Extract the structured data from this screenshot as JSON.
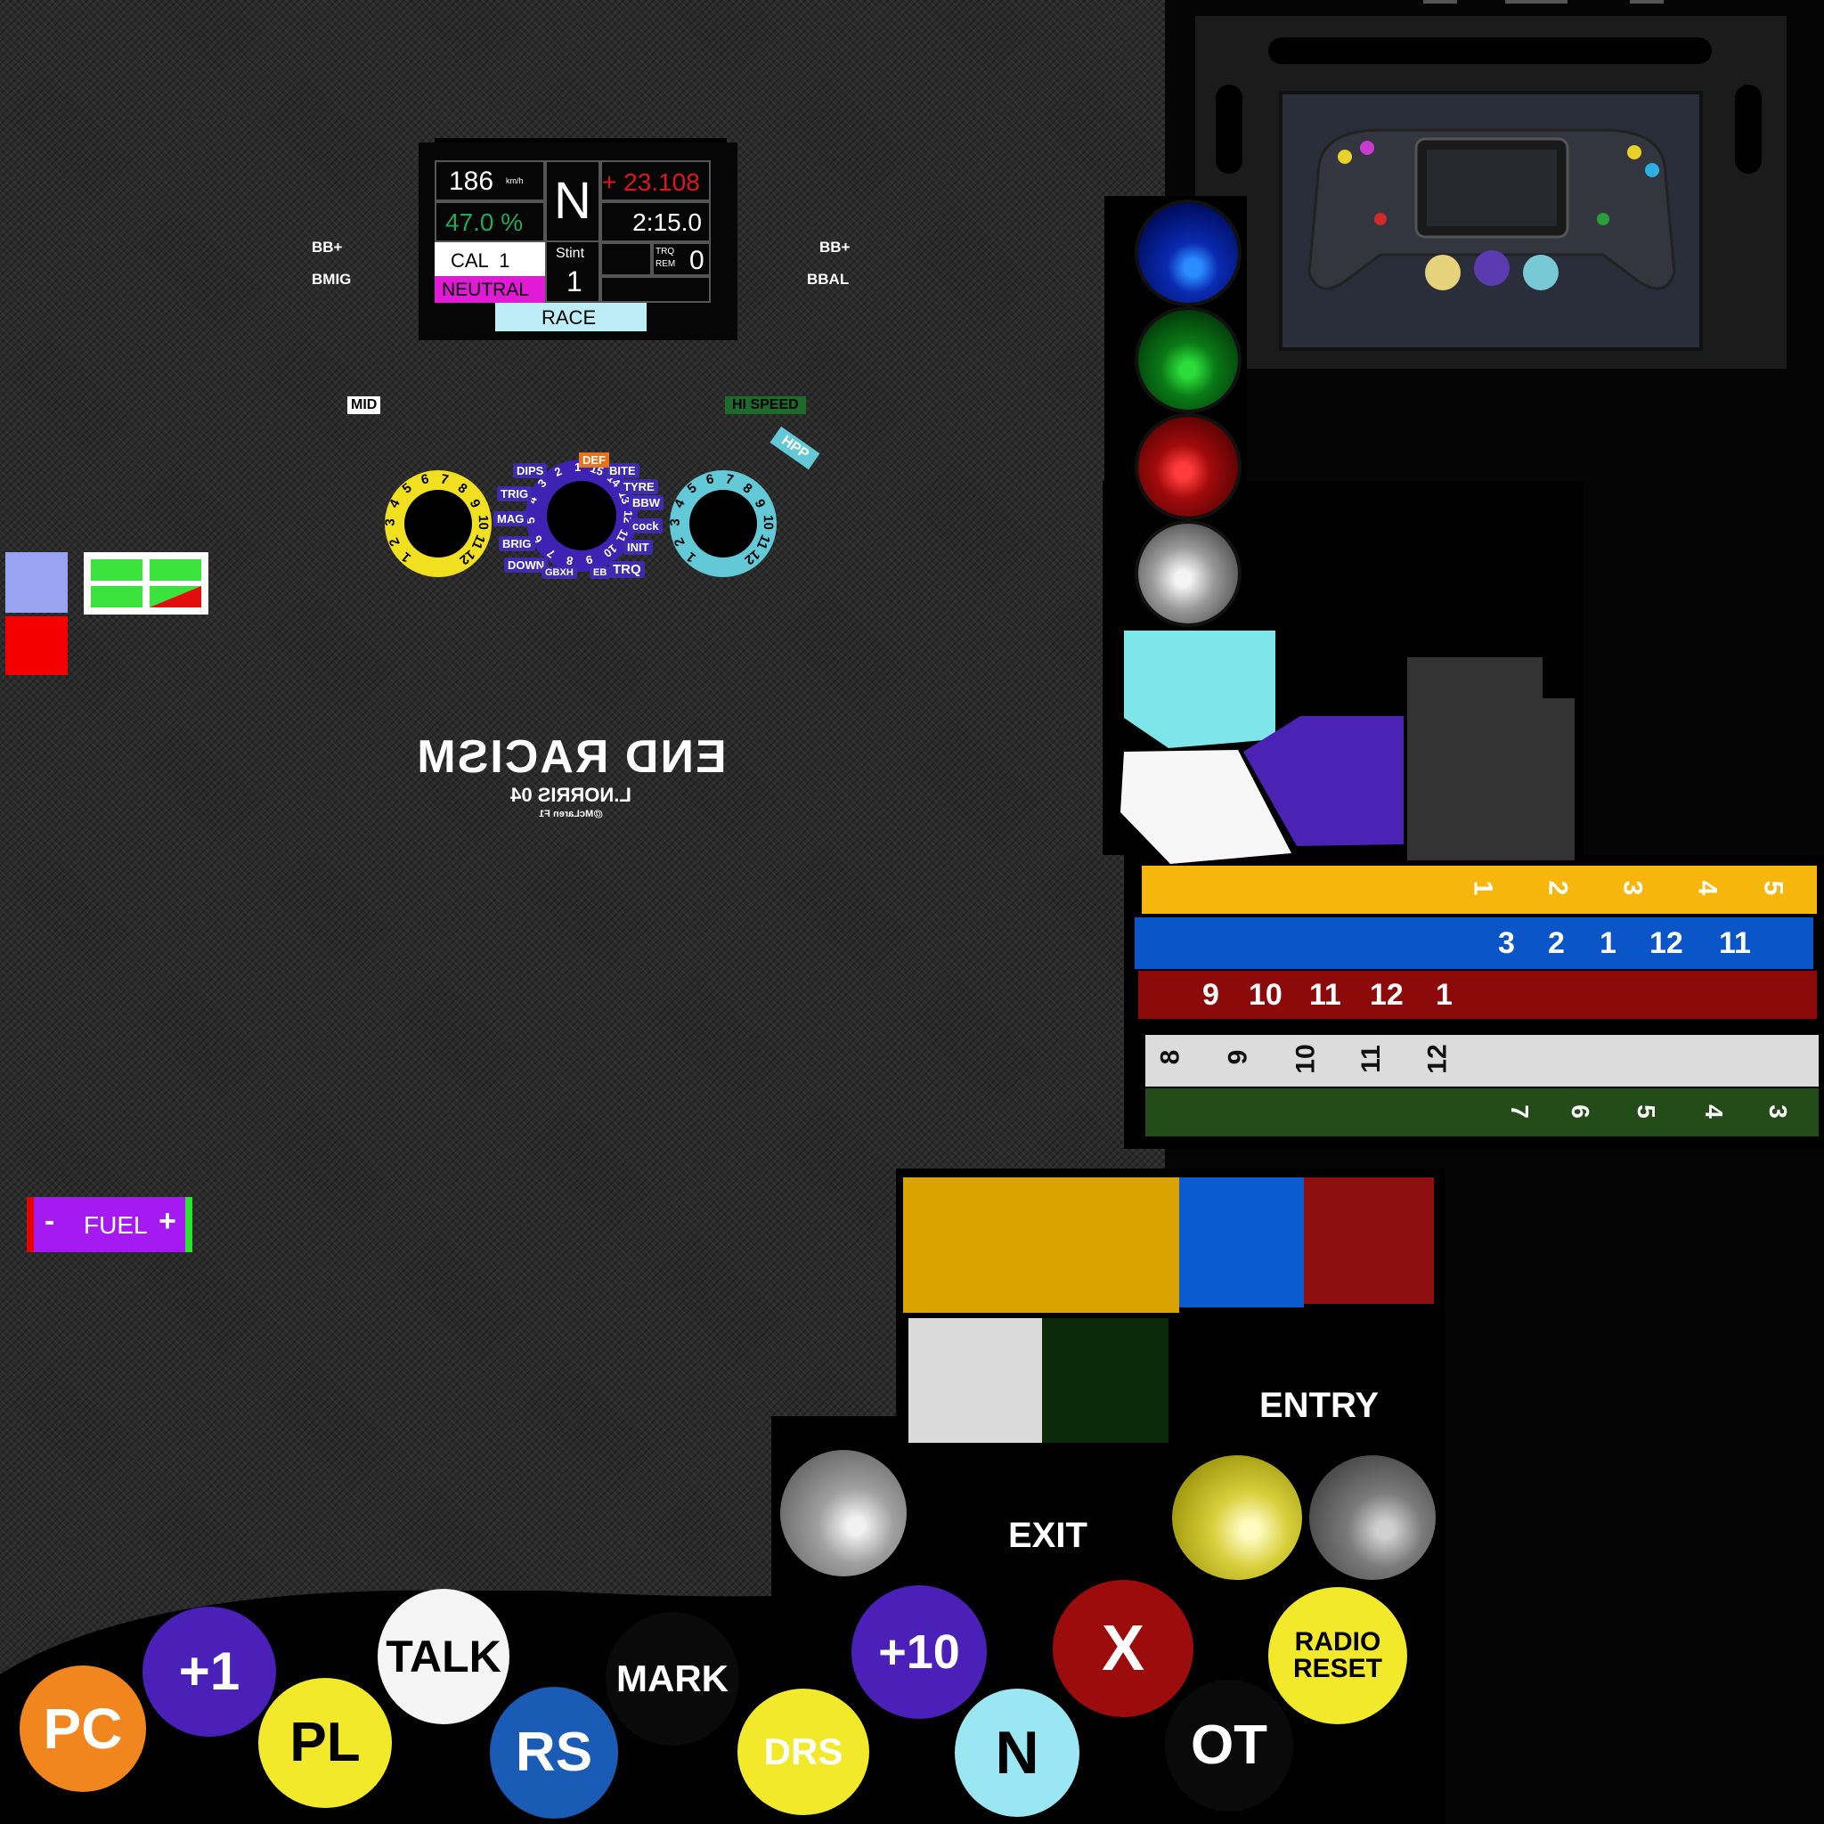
{
  "dash": {
    "speed": "186",
    "speed_unit": "km/h",
    "gear": "N",
    "delta": "+ 23.108",
    "fuel_pct": "47.0 %",
    "laptime": "2:15.0",
    "cal": "CAL  1",
    "stint_label": "Stint",
    "stint_value": "1",
    "trq_rem": "TRQ\nREM",
    "trq_value": "0",
    "mode": "NEUTRAL",
    "session": "RACE"
  },
  "labels": {
    "bb_left": "BB+",
    "bmig": "BMIG",
    "bb_right": "BB+",
    "bbal": "BBAL",
    "mid": "MID",
    "hi_speed": "HI SPEED",
    "hpp": "HPP",
    "def": "DEF"
  },
  "rotary_left": [
    "1",
    "2",
    "3",
    "4",
    "5",
    "6",
    "7",
    "8",
    "9",
    "10",
    "11",
    "12"
  ],
  "rotary_center": {
    "numbers": [
      "1",
      "2",
      "3",
      "4",
      "5",
      "6",
      "7",
      "8",
      "9",
      "10",
      "11",
      "12",
      "13",
      "14",
      "15"
    ],
    "functions": [
      "DIPS",
      "TRIG",
      "MAG",
      "BRIG",
      "DOWN",
      "GBXH",
      "EB",
      "TRQ",
      "INIT",
      "cock",
      "BBW",
      "TYRE",
      "BITE"
    ]
  },
  "rotary_right": [
    "1",
    "2",
    "3",
    "4",
    "5",
    "6",
    "7",
    "8",
    "9",
    "10",
    "11",
    "12"
  ],
  "slogan": {
    "line1": "END RACISM",
    "line2": "L.NORRIS 04",
    "line3": "@McLaren F1"
  },
  "fuel": {
    "minus": "-",
    "label": "FUEL",
    "plus": "+"
  },
  "strips": {
    "yellow": [
      "1",
      "2",
      "3",
      "4",
      "5"
    ],
    "blue": [
      "3",
      "2",
      "1",
      "12",
      "11"
    ],
    "red": [
      "9",
      "10",
      "11",
      "12",
      "1"
    ],
    "white": [
      "8",
      "9",
      "10",
      "11",
      "12"
    ],
    "green": [
      "7",
      "6",
      "5",
      "4",
      "3"
    ]
  },
  "entry_label": "ENTRY",
  "exit_label": "EXIT",
  "buttons": {
    "pc": "PC",
    "plus1": "+1",
    "pl": "PL",
    "talk": "TALK",
    "rs": "RS",
    "mark": "MARK",
    "drs": "DRS",
    "plus10": "+10",
    "n": "N",
    "x": "X",
    "ot": "OT",
    "radio_reset": "RADIO RESET"
  },
  "colors": {
    "orange": "#f0861d",
    "purple": "#4a20b8",
    "yellow": "#f1e92a",
    "white": "#f5f5f5",
    "blue": "#1a5bb5",
    "black": "#0a0a0a",
    "cyan": "#9be6f3",
    "red": "#9c0c0c"
  }
}
